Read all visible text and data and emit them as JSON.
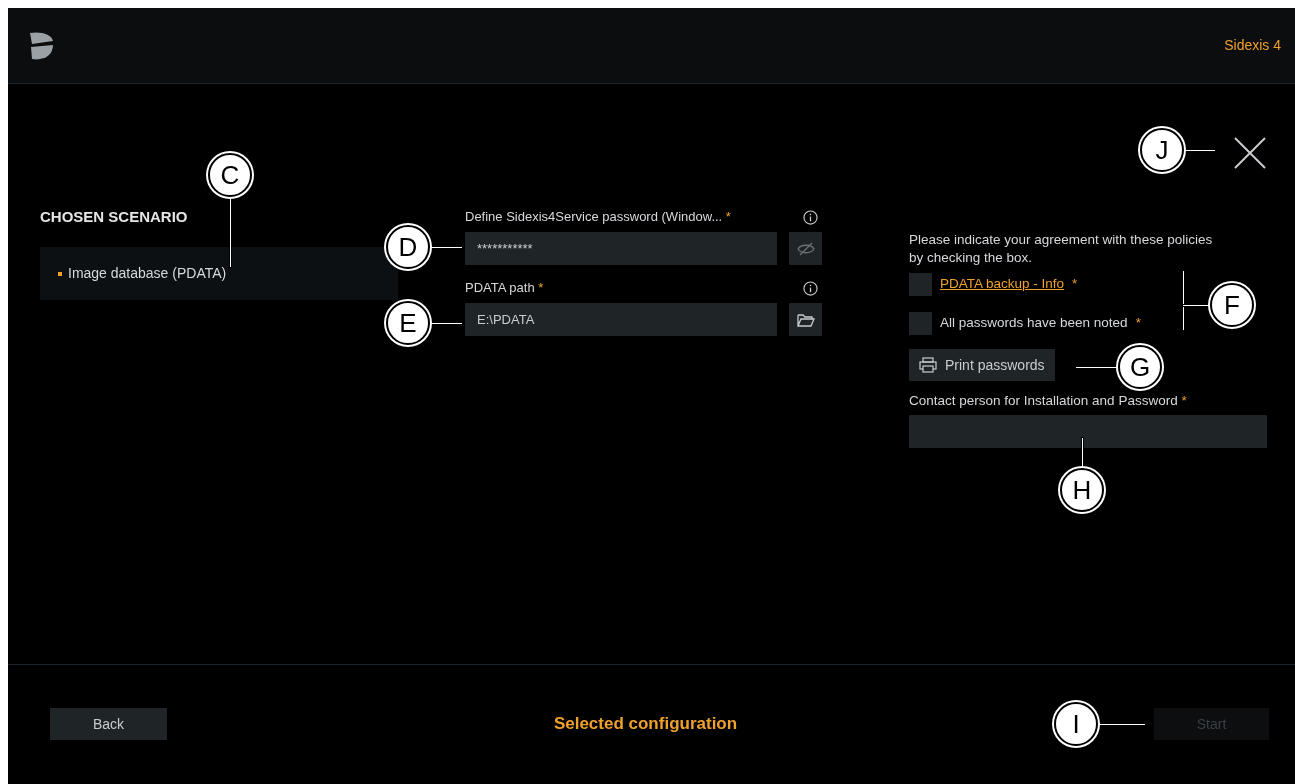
{
  "header": {
    "product_name": "Sidexis 4"
  },
  "scenario": {
    "title": "CHOSEN SCENARIO",
    "items": [
      {
        "label": "Image database (PDATA)"
      }
    ]
  },
  "fields": [
    {
      "kind": "password",
      "label": "Define Sidexis4Service password (Window...",
      "required_mark": "*",
      "info": true,
      "value": "***********"
    },
    {
      "kind": "path",
      "label": "PDATA path",
      "required_mark": "*",
      "info": true,
      "value": "E:\\PDATA"
    }
  ],
  "agreement": {
    "text": "Please indicate your agreement with these policies by checking the box.",
    "checks": [
      {
        "label": "PDATA backup - Info",
        "link": true,
        "required_mark": "*",
        "checked": false
      },
      {
        "label": "All passwords have been noted",
        "link": false,
        "required_mark": "*",
        "checked": false
      }
    ]
  },
  "print_button": "Print passwords",
  "contact": {
    "label": "Contact person for Installation and Password",
    "required_mark": "*"
  },
  "footer": {
    "back": "Back",
    "title": "Selected configuration",
    "start": {
      "label": "Start",
      "disabled": true
    }
  },
  "callouts": [
    {
      "letter": "C"
    },
    {
      "letter": "D"
    },
    {
      "letter": "E"
    },
    {
      "letter": "F"
    },
    {
      "letter": "G"
    },
    {
      "letter": "H"
    },
    {
      "letter": "I"
    },
    {
      "letter": "J"
    }
  ]
}
